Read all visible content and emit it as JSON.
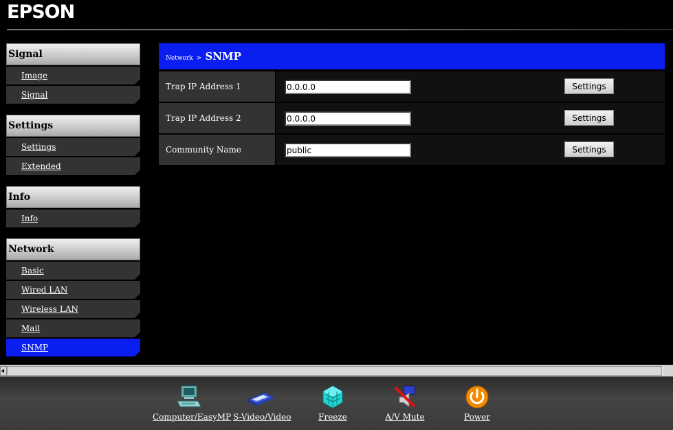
{
  "header": {
    "logo": "EPSON"
  },
  "sidebar": {
    "sections": [
      {
        "title": "Signal",
        "items": [
          "Image",
          "Signal"
        ]
      },
      {
        "title": "Settings",
        "items": [
          "Settings",
          "Extended"
        ]
      },
      {
        "title": "Info",
        "items": [
          "Info"
        ]
      },
      {
        "title": "Network",
        "items": [
          "Basic",
          "Wired LAN",
          "Wireless LAN",
          "Mail",
          "SNMP"
        ]
      }
    ],
    "active_item": "SNMP"
  },
  "panel": {
    "breadcrumb": "Network",
    "breadcrumb_sep": ">",
    "title": "SNMP",
    "rows": [
      {
        "label": "Trap IP Address 1",
        "value": "0.0.0.0",
        "button": "Settings"
      },
      {
        "label": "Trap IP Address 2",
        "value": "0.0.0.0",
        "button": "Settings"
      },
      {
        "label": "Community Name",
        "value": "public",
        "button": "Settings"
      }
    ]
  },
  "toolbar": {
    "items": [
      {
        "label": "Computer/EasyMP",
        "icon": "computer-icon"
      },
      {
        "label": "S-Video/Video",
        "icon": "video-device-icon"
      },
      {
        "label": "Freeze",
        "icon": "freeze-icon"
      },
      {
        "label": "A/V Mute",
        "icon": "av-mute-icon"
      },
      {
        "label": "Power",
        "icon": "power-icon"
      }
    ]
  },
  "colors": {
    "accent_blue": "#0a1ef0",
    "power_orange": "#f08a00",
    "freeze_cyan": "#22d4d4"
  }
}
